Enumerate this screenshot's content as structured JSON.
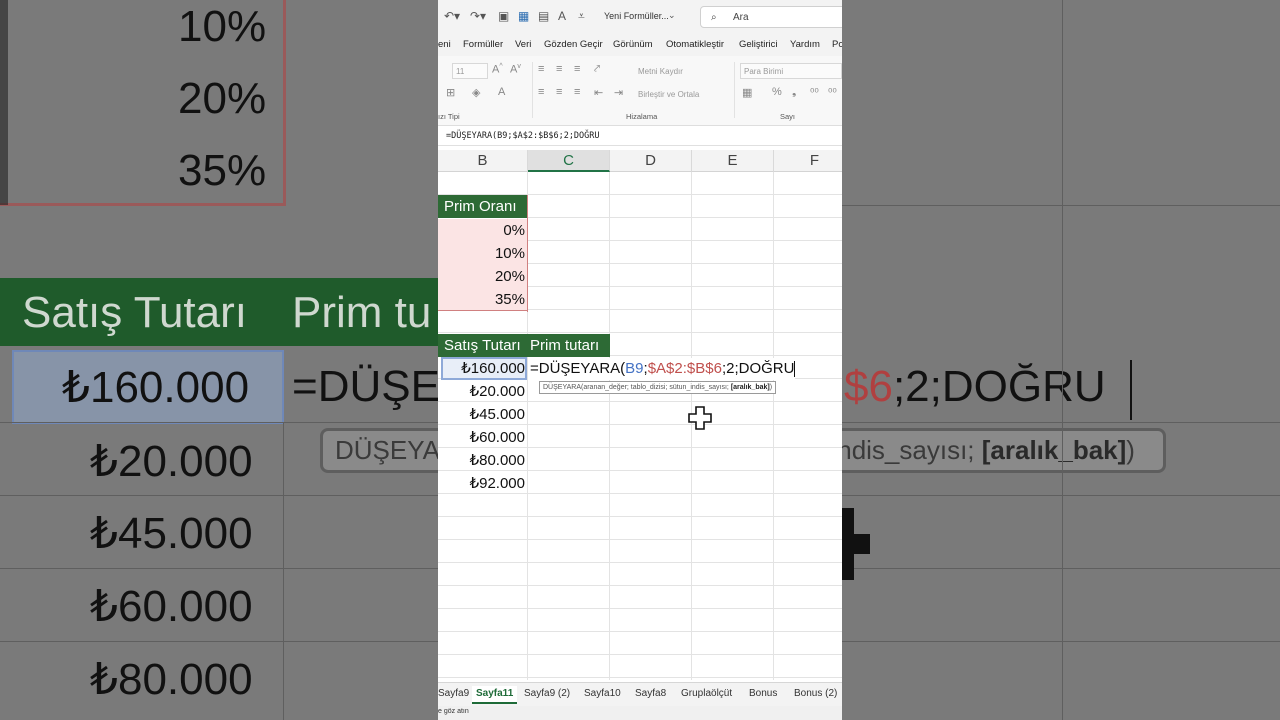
{
  "app": {
    "title": "Yeni Formüller...",
    "search_placeholder": "Ara"
  },
  "menu": [
    "eni",
    "Formüller",
    "Veri",
    "Gözden Geçir",
    "Görünüm",
    "Otomatikleştir",
    "Geliştirici",
    "Yardım",
    "Po"
  ],
  "ribbon": {
    "font_size": "11",
    "wrap_text": "Metni Kaydır",
    "merge_center": "Birleştir ve Ortala",
    "number_format": "Para Birimi",
    "group_font": "ızı Tipi",
    "group_alignment": "Hizalama",
    "group_number": "Sayı"
  },
  "formula_bar": "=DÜŞEYARA(B9;$A$2:$B$6;2;DOĞRU",
  "columns": [
    "B",
    "C",
    "D",
    "E",
    "F"
  ],
  "table1": {
    "header": "Prim Oranı",
    "values": [
      "0%",
      "10%",
      "20%",
      "35%"
    ]
  },
  "table2": {
    "header_b": "Satış Tutarı",
    "header_c": "Prim tutarı",
    "values": [
      "₺160.000",
      "₺20.000",
      "₺45.000",
      "₺60.000",
      "₺80.000",
      "₺92.000"
    ]
  },
  "editing": {
    "prefix": "=DÜŞEYARA(",
    "ref_cell": "B9",
    "sep1": ";",
    "ref_range": "$A$2:$B$6",
    "suffix": ";2;DOĞRU"
  },
  "tooltip": {
    "text": "DÜŞEYARA(aranan_değer; tablo_dizisi; sütun_indis_sayısı; ",
    "bold": "[aralık_bak]",
    "close": ")"
  },
  "sheets": [
    "Sayfa9",
    "Sayfa11",
    "Sayfa9 (2)",
    "Sayfa10",
    "Sayfa8",
    "Gruplaölçüt",
    "Bonus",
    "Bonus (2)"
  ],
  "active_sheet": "Sayfa11",
  "status": "e göz atın",
  "background": {
    "left_percents": [
      "10%",
      "20%",
      "35%"
    ],
    "left_header1": "Satış Tutarı",
    "left_header2": "Prim tu",
    "left_values": [
      "₺160.000",
      "₺20.000",
      "₺45.000",
      "₺60.000",
      "₺80.000"
    ],
    "left_formula": "=DÜŞE",
    "left_tip": "DÜŞEYAR",
    "right_formula_red": "$6",
    "right_formula_rest": ";2;DOĞRU",
    "right_tip_text": "_indis_sayısı; ",
    "right_tip_bold": "[aralık_bak]",
    "right_tip_close": ")"
  },
  "colors": {
    "header_green": "#2d6a35",
    "accent_green": "#217346",
    "ref_blue": "#4472c4",
    "ref_red": "#c0504d"
  }
}
